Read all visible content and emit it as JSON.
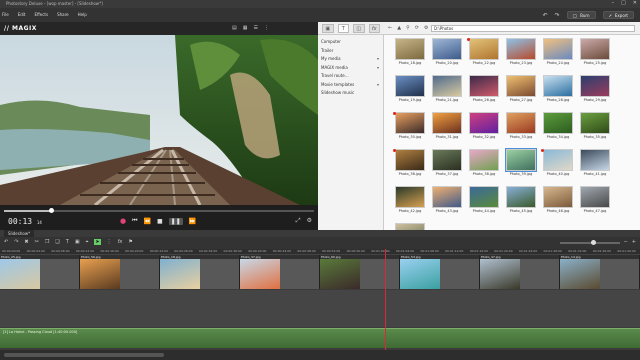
{
  "window": {
    "title": "Photostory Deluxe - [wop master] - [Slideshow*]",
    "controls": [
      "–",
      "□",
      "✕"
    ]
  },
  "menu": [
    "File",
    "Edit",
    "Effects",
    "Share",
    "Help"
  ],
  "toolbar_right": {
    "burn_label": "Burn",
    "export_label": "Export"
  },
  "brand": {
    "logo": "// MAGIX"
  },
  "pool_nav": {
    "items": [
      {
        "label": "Computer",
        "arrow": ""
      },
      {
        "label": "Trailer",
        "arrow": ""
      },
      {
        "label": "My media",
        "arrow": "▾"
      },
      {
        "label": "MAGIX media",
        "arrow": "▾"
      },
      {
        "label": "Travel route…",
        "arrow": ""
      },
      {
        "label": "Movie templates",
        "arrow": "▾"
      },
      {
        "label": "Slideshow music",
        "arrow": ""
      }
    ]
  },
  "browser": {
    "path": "D:\\Photos",
    "photos": [
      {
        "name": "Photo_18.jpg",
        "c1": "#c7b58a",
        "c2": "#7d6a3e"
      },
      {
        "name": "Photo_20.jpg",
        "c1": "#9fb7d6",
        "c2": "#3d5b8c"
      },
      {
        "name": "Photo_22.jpg",
        "c1": "#e2c27a",
        "c2": "#b0752e"
      },
      {
        "name": "Photo_23.jpg",
        "c1": "#8ec2e8",
        "c2": "#b84a2a"
      },
      {
        "name": "Photo_24.jpg",
        "c1": "#f0c080",
        "c2": "#6a8ac0"
      },
      {
        "name": "Photo_25.jpg",
        "c1": "#caa",
        "c2": "#6b4b3a"
      },
      {
        "name": "Photo_19.jpg",
        "c1": "#6b8fc4",
        "c2": "#20304a"
      },
      {
        "name": "Photo_21.jpg",
        "c1": "#4f6b8c",
        "c2": "#d8c9a0"
      },
      {
        "name": "Photo_26.jpg",
        "c1": "#3b2a4a",
        "c2": "#d05a6a"
      },
      {
        "name": "Photo_27.jpg",
        "c1": "#f0c070",
        "c2": "#7a4a30"
      },
      {
        "name": "Photo_28.jpg",
        "c1": "#c8e0f0",
        "c2": "#2a6ea0"
      },
      {
        "name": "Photo_29.jpg",
        "c1": "#2b3f70",
        "c2": "#9a3c5c"
      },
      {
        "name": "Photo_30.jpg",
        "c1": "#e8a060",
        "c2": "#3a2a2a"
      },
      {
        "name": "Photo_31.jpg",
        "c1": "#f2a040",
        "c2": "#6a3020"
      },
      {
        "name": "Photo_32.jpg",
        "c1": "#d04080",
        "c2": "#6020a0"
      },
      {
        "name": "Photo_33.jpg",
        "c1": "#e0a060",
        "c2": "#9a3a20"
      },
      {
        "name": "Photo_34.jpg",
        "c1": "#5c9c3c",
        "c2": "#2c5c20"
      },
      {
        "name": "Photo_35.jpg",
        "c1": "#6aa040",
        "c2": "#304a18"
      },
      {
        "name": "Photo_36.jpg",
        "c1": "#b08040",
        "c2": "#3a2a18"
      },
      {
        "name": "Photo_37.jpg",
        "c1": "#6a7a5a",
        "c2": "#2a3020"
      },
      {
        "name": "Photo_38.jpg",
        "c1": "#e8a8c8",
        "c2": "#70a050"
      },
      {
        "name": "Photo_39.jpg",
        "c1": "#9ad0a0",
        "c2": "#407060"
      },
      {
        "name": "Photo_40.jpg",
        "c1": "#8ab8d8",
        "c2": "#e0d8c8"
      },
      {
        "name": "Photo_41.jpg",
        "c1": "#3a4a5a",
        "c2": "#c8d8e8"
      },
      {
        "name": "Photo_42.jpg",
        "c1": "#2a3a2a",
        "c2": "#d8a050"
      },
      {
        "name": "Photo_43.jpg",
        "c1": "#f0b070",
        "c2": "#405a8a"
      },
      {
        "name": "Photo_44.jpg",
        "c1": "#3a6a9a",
        "c2": "#5a8a3a"
      },
      {
        "name": "Photo_45.jpg",
        "c1": "#88b0d8",
        "c2": "#3a5a2a"
      },
      {
        "name": "Photo_46.jpg",
        "c1": "#d8b890",
        "c2": "#7a5a3a"
      },
      {
        "name": "Photo_47.jpg",
        "c1": "#a0a8b0",
        "c2": "#484848"
      },
      {
        "name": "Photo_48.jpg",
        "c1": "#d0c0a0",
        "c2": "#5a6a4a"
      }
    ],
    "selected_photo": "Photo_39.jpg"
  },
  "playback": {
    "timecode": "00:13",
    "timecode_frames": "14",
    "progress": 0.15
  },
  "timeline": {
    "tab_label": "Slideshow*",
    "ruler_labels": [
      "00:00:00:00",
      "00:00:04:00",
      "00:00:08:00",
      "00:00:12:00",
      "00:00:16:00",
      "00:00:20:00",
      "00:00:24:00",
      "00:00:28:00",
      "00:00:32:00",
      "00:00:36:00",
      "00:00:40:00",
      "00:00:44:00",
      "00:00:48:00",
      "00:00:52:00",
      "00:00:56:00",
      "00:01:00:00",
      "00:01:04:00",
      "00:01:08:00",
      "00:01:12:00",
      "00:01:16:00",
      "00:01:20:00",
      "00:01:24:00",
      "00:01:28:00",
      "00:01:32:00",
      "00:01:36:00",
      "00:01:40:00"
    ],
    "clips": [
      {
        "label": "Photo_25.jpg",
        "c1": "#9ec8e8",
        "c2": "#d8c8a0"
      },
      {
        "label": "Photo_56.jpg",
        "c1": "#e8a050",
        "c2": "#5a3a20"
      },
      {
        "label": "Photo_18.jpg",
        "c1": "#80b0d0",
        "c2": "#e8d0a0"
      },
      {
        "label": "Photo_37.jpg",
        "c1": "#c8d8e8",
        "c2": "#e07040"
      },
      {
        "label": "Photo_60.jpg",
        "c1": "#5a7a3a",
        "c2": "#3a2a2a"
      },
      {
        "label": "Photo_53.jpg",
        "c1": "#9ad0f0",
        "c2": "#3aa0a0"
      },
      {
        "label": "Photo_47.jpg",
        "c1": "#b0c0d0",
        "c2": "#3a3a2a"
      },
      {
        "label": "Photo_14.jpg",
        "c1": "#8ab0c8",
        "c2": "#5a4a30"
      }
    ],
    "audio_label": "[1] La Haine - Passing Cloud [1:40:00.000]",
    "zoom": 0.55,
    "playhead_time": "00:01:08:00"
  }
}
